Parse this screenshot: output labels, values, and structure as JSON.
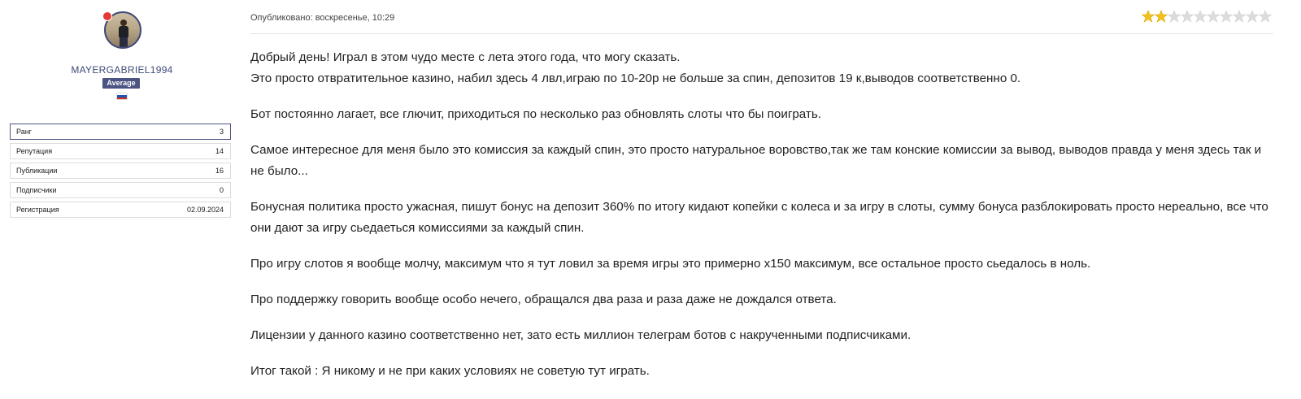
{
  "profile": {
    "username": "MAYERGABRIEL1994",
    "rank_badge": "Average",
    "stats": [
      {
        "label": "Ранг",
        "value": "3"
      },
      {
        "label": "Репутация",
        "value": "14"
      },
      {
        "label": "Публикации",
        "value": "16"
      },
      {
        "label": "Подписчики",
        "value": "0"
      },
      {
        "label": "Регистрация",
        "value": "02.09.2024"
      }
    ]
  },
  "post": {
    "published": "Опубликовано: воскресенье, 10:29",
    "rating": {
      "filled": 2,
      "total": 10,
      "color_filled": "#f2c21a",
      "color_empty": "#dcdcdc"
    },
    "paragraphs": [
      [
        "Добрый день! Играл в этом чудо месте с лета этого года, что могу сказать.",
        "Это просто отвратительное казино, набил здесь 4 лвл,играю по 10-20р не больше за спин, депозитов 19 к,выводов соответственно 0."
      ],
      [
        "Бот постоянно лагает, все глючит, приходиться по несколько раз обновлять слоты что бы поиграть."
      ],
      [
        "Самое интересное для меня было это комиссия за каждый спин, это просто натуральное воровство,так же там конские комиссии за вывод, выводов правда у меня здесь так и не было..."
      ],
      [
        "Бонусная политика просто ужасная, пишут бонус на депозит 360% по итогу кидают копейки с колеса и за игру в слоты, сумму бонуса разблокировать просто нереально, все что они дают за игру сьедаеться комиссиями за каждый спин."
      ],
      [
        "Про игру слотов я вообще молчу, максимум что я тут ловил за время игры это примерно х150 максимум, все остальное просто сьедалось в ноль."
      ],
      [
        "Про поддержку говорить вообще особо нечего, обращался два раза и раза даже не дождался ответа."
      ],
      [
        "Лицензии у данного казино соответственно нет, зато есть миллион телеграм ботов с накрученными подписчиками."
      ],
      [
        "Итог такой : Я никому и не при каких условиях не советую тут играть."
      ]
    ]
  }
}
